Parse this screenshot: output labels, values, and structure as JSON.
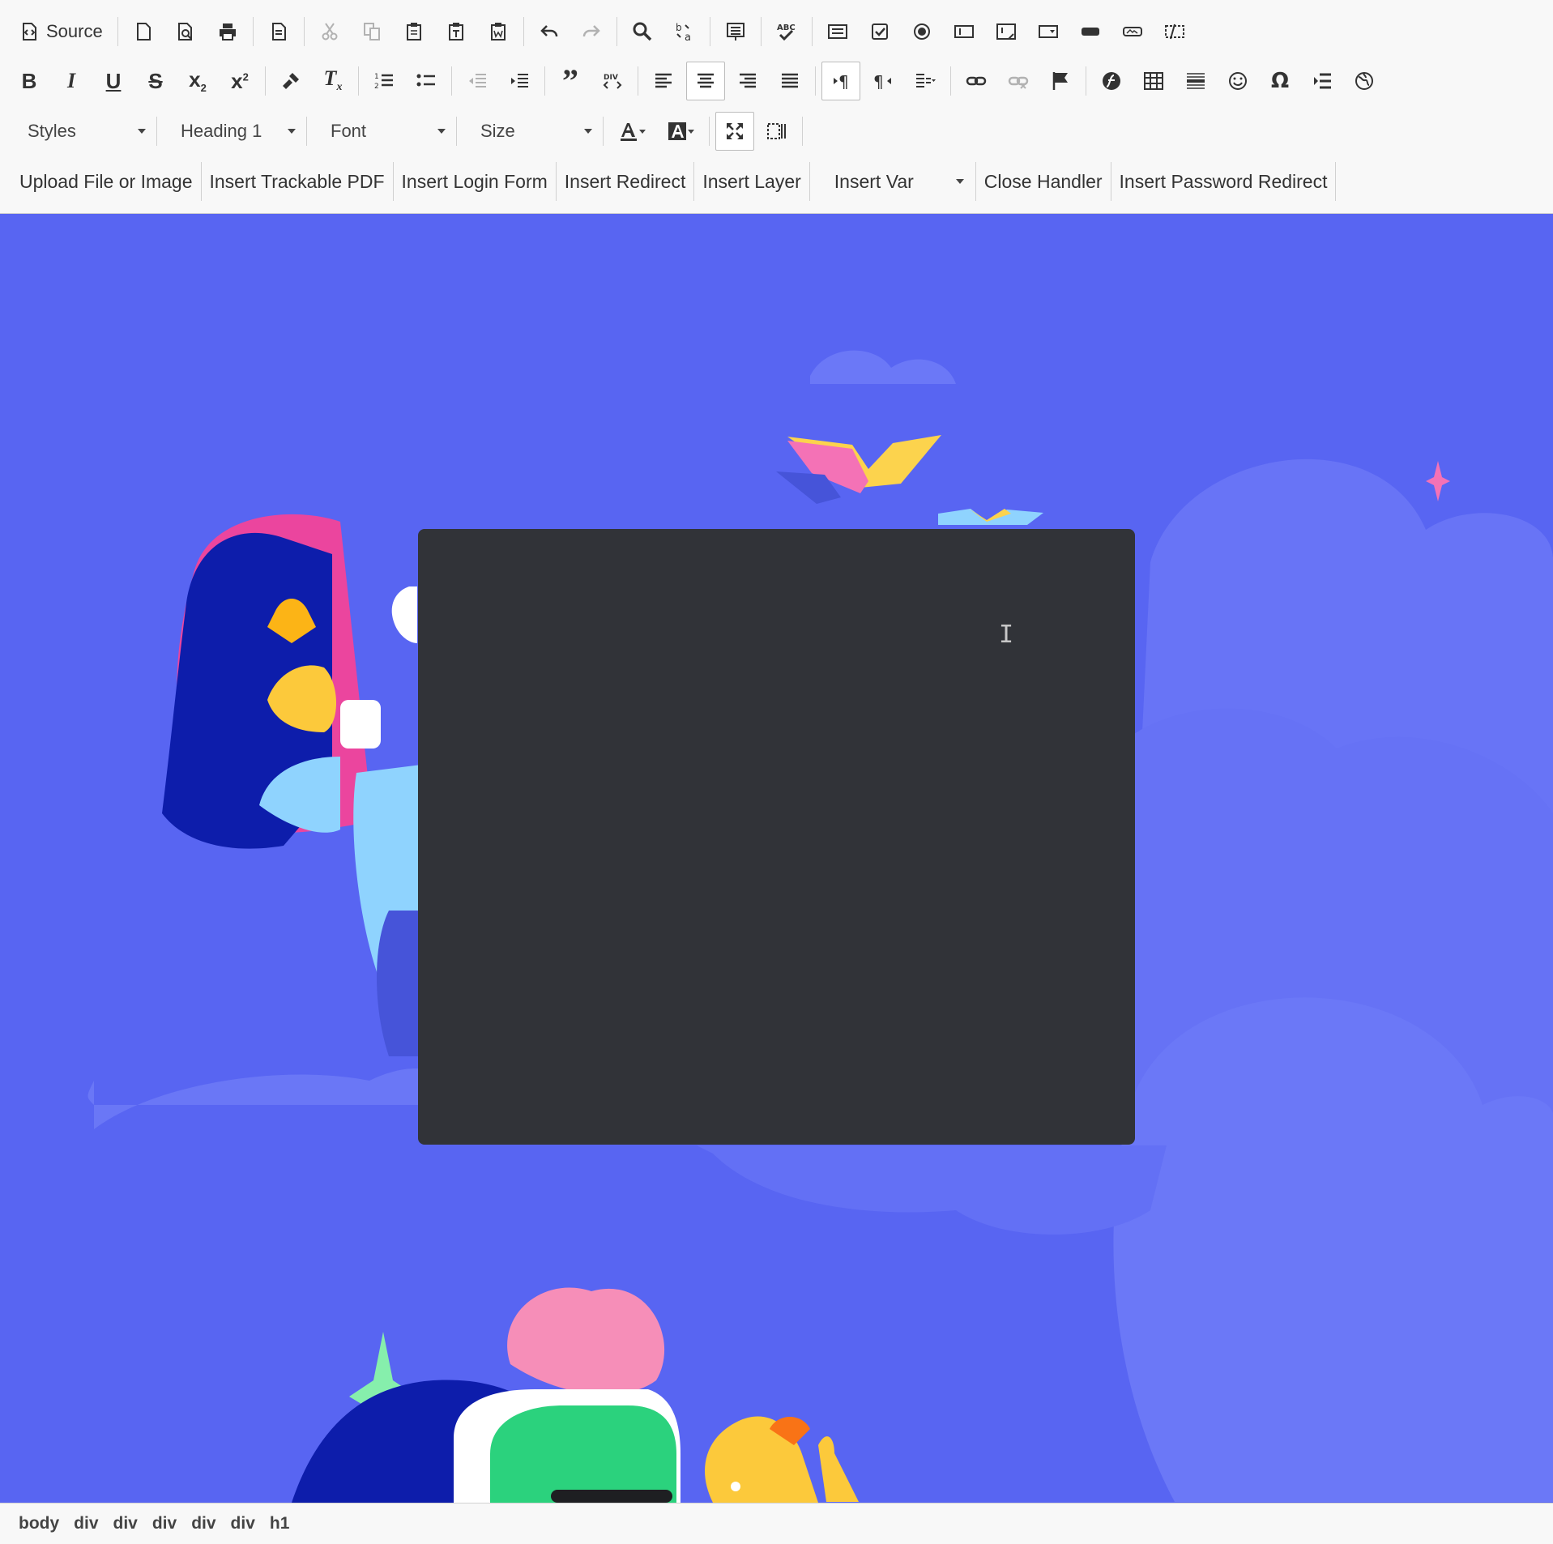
{
  "toolbar": {
    "source_label": "Source",
    "styles_label": "Styles",
    "format_label": "Heading 1",
    "font_label": "Font",
    "size_label": "Size",
    "plugin_buttons": [
      "Upload File or Image",
      "Insert Trackable PDF",
      "Insert Login Form",
      "Insert Redirect",
      "Insert Layer",
      "Insert Var",
      "Close Handler",
      "Insert Password Redirect"
    ]
  },
  "status_bar": {
    "path": [
      "body",
      "div",
      "div",
      "div",
      "div",
      "div",
      "h1"
    ]
  },
  "colors": {
    "canvas_background": "#5865f2",
    "dark_panel": "#313338",
    "toolbar_background": "#f8f8f8"
  }
}
